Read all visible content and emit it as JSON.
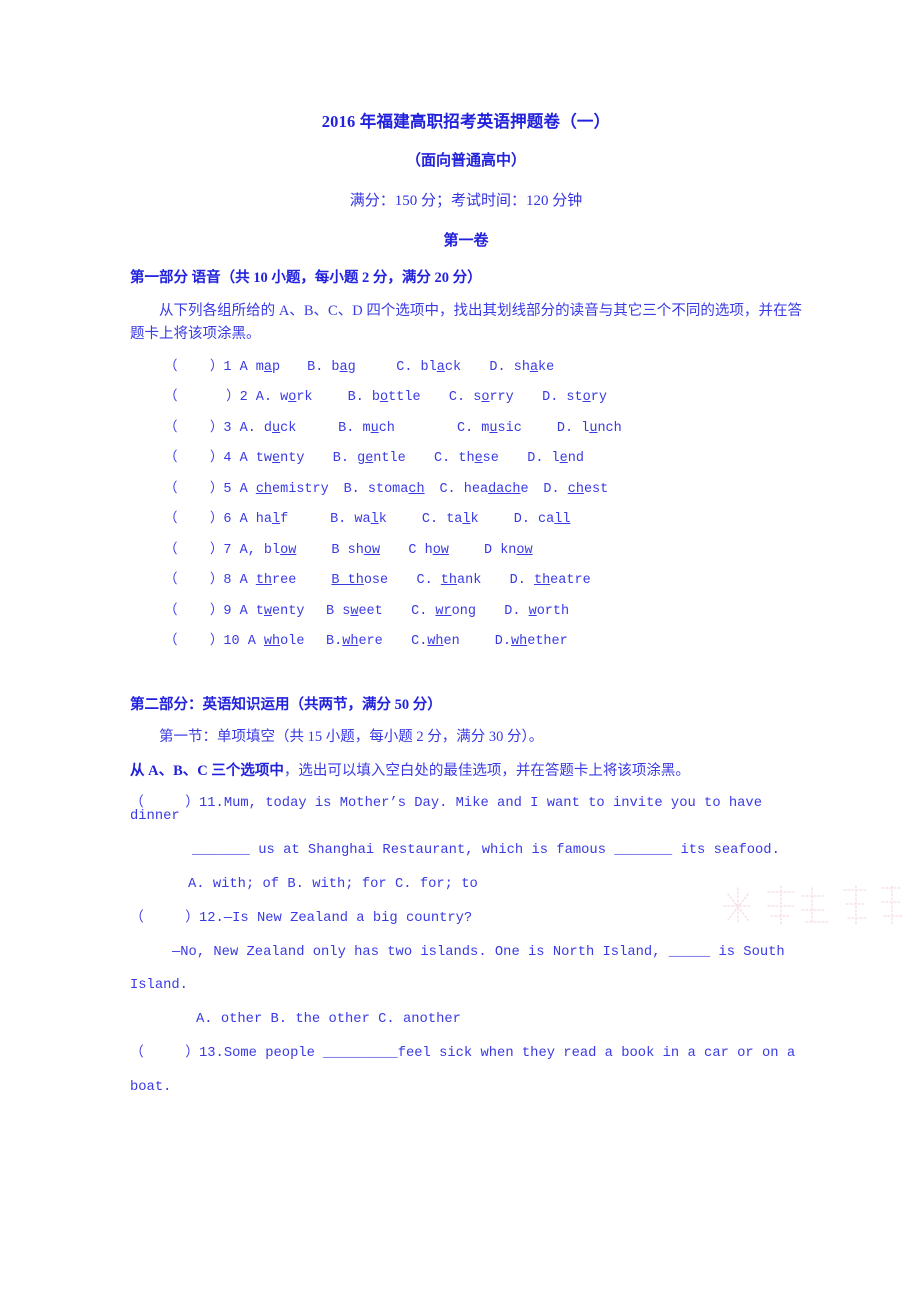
{
  "document": {
    "title": "2016 年福建高职招考英语押题卷（一）",
    "subtitle": "（面向普通高中）",
    "score_line": "满分：150 分；考试时间：120 分钟",
    "paper_number": "第一卷",
    "text_color": "#3a3ae4",
    "heading_color": "#2222dd"
  },
  "part_one": {
    "heading": "第一部分 语音（共 10 小题，每小题 2 分，满分 20 分）",
    "instruction": "从下列各组所给的 A、B、C、D 四个选项中，找出其划线部分的读音与其它三个不同的选项，并在答题卡上将该项涂黑。",
    "questions": [
      {
        "number": "1",
        "options": "（    ）1 A m<u>a</u>p  B. b<u>a</u>g   C. bl<u>a</u>ck   D. sh<u>a</u>ke"
      },
      {
        "number": "2",
        "options": "（      ）2 A. w<u>o</u>rk   B. b<u>o</u>ttle   C. s<u>o</u>rry   D. st<u>o</u>ry"
      },
      {
        "number": "3",
        "options": "（    ）3 A. d<u>u</u>ck    B. m<u>u</u>ch     C. m<u>u</u>sic   D. l<u>u</u>nch"
      },
      {
        "number": "4",
        "options": "（    ）4 A tw<u>e</u>nty   B. g<u>e</u>ntle   C. th<u>e</u>se   D. l<u>e</u>nd"
      },
      {
        "number": "5",
        "options": "（    ）5 A <u>ch</u>emistry  B. stoma<u>ch</u>  C. hea<u>dach</u>e  D. <u>ch</u>est"
      },
      {
        "number": "6",
        "options": "（    ）6 A ha<u>l</u>f    B. wa<u>l</u>k    C. ta<u>l</u>k   D. ca<u>ll</u>"
      },
      {
        "number": "7",
        "options": "（    ）7 A, bl<u>ow</u>   B sh<u>ow</u>   C h<u>ow</u>   D kn<u>ow</u>"
      },
      {
        "number": "8",
        "options": "（    ）8 A <u>th</u>ree   <u>B th</u>ose   C. <u>th</u>ank   D. <u>th</u>eatre"
      },
      {
        "number": "9",
        "options": "（    ）9 A t<u>w</u>enty  B s<u>w</u>eet   C. <u>wr</u>ong   D. <u>w</u>orth"
      },
      {
        "number": "10",
        "options": "（    ）10 A <u>wh</u>ole  B.<u>wh</u>ere   C.<u>wh</u>en   D.<u>wh</u>ether"
      }
    ]
  },
  "part_two": {
    "heading": "第二部分：英语知识运用（共两节，满分 50 分）",
    "subsection": "第一节：单项填空（共 15 小题，每小题 2 分，满分 30 分）。",
    "instruction_bold": "从 A、B、C 三个选项中",
    "instruction_rest": "，选出可以填入空白处的最佳选项，并在答题卡上将该项涂黑。",
    "questions": [
      {
        "number": "11",
        "line1": "（     ）11.Mum, today is Mother’s Day. Mike and I want to invite you to have dinner",
        "line2": "_______ us at Shanghai Restaurant, which is famous _______ its seafood.",
        "options": "A. with; of B. with; for C. for; to"
      },
      {
        "number": "12",
        "line1": "（     ）12.—Is New Zealand a big country?",
        "line2": "—No, New Zealand only has two islands. One is North Island, _____ is South",
        "line3": "Island.",
        "options": "A. other B. the other C. another"
      },
      {
        "number": "13",
        "line1": "（     ）13.Some people _________feel sick when they read a book in a car or on a",
        "line2": "boat."
      }
    ]
  },
  "watermark": {
    "name": "site-watermark",
    "color": "#e8a0b8"
  }
}
